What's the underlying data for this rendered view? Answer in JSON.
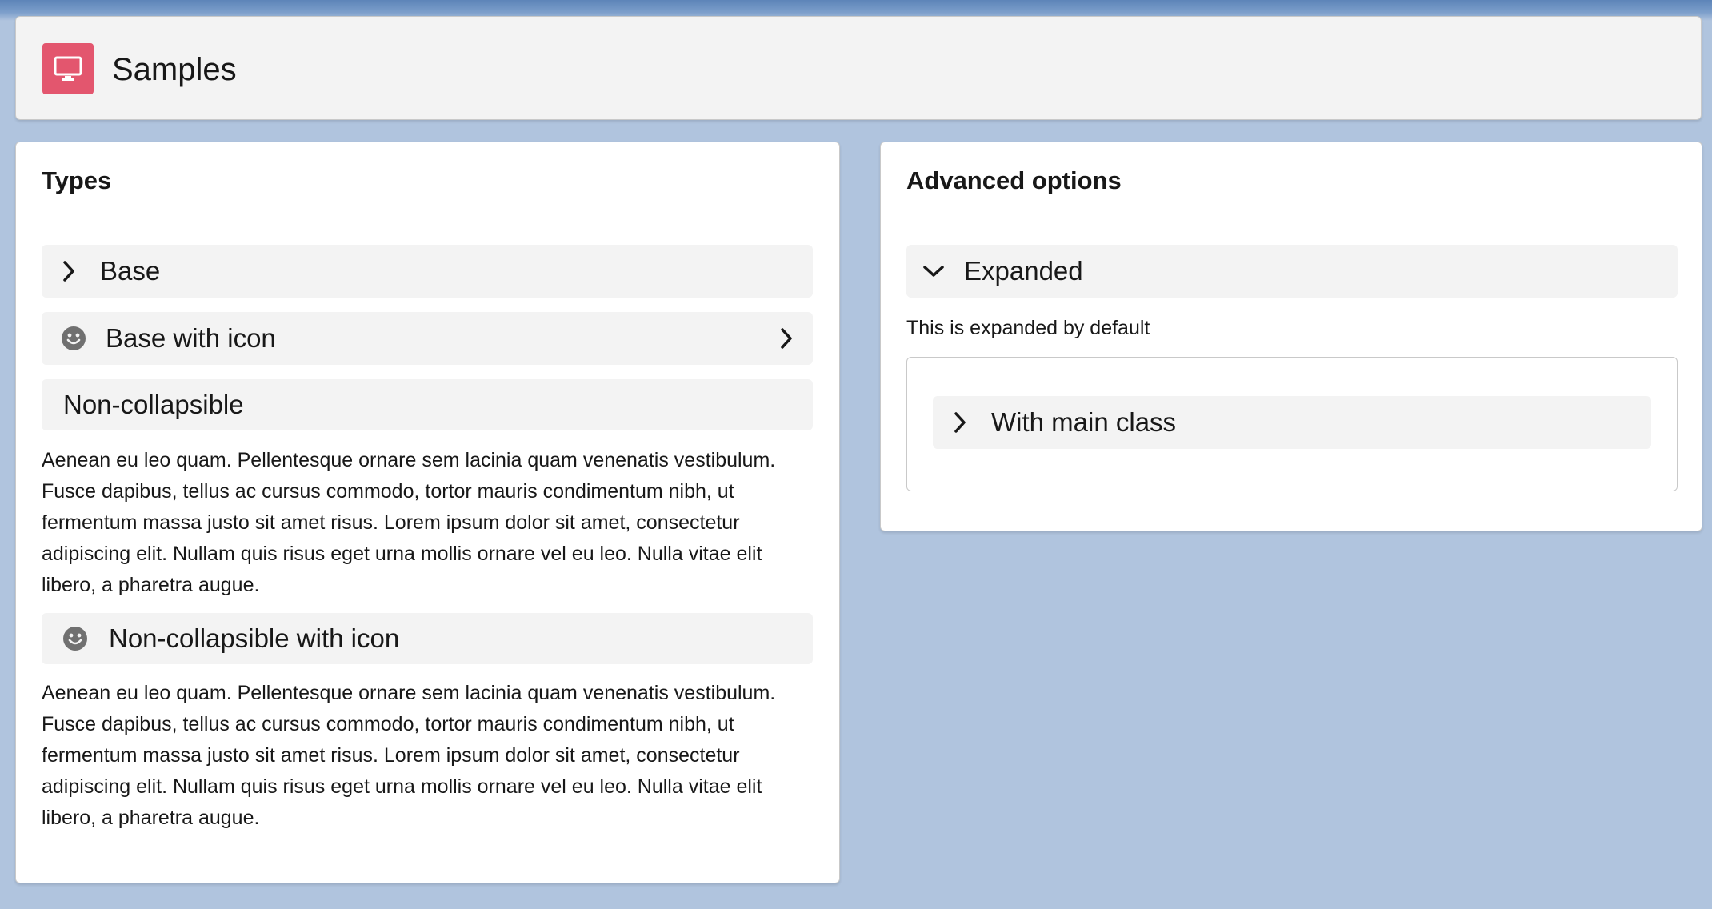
{
  "header": {
    "title": "Samples",
    "icon": "desktop-icon",
    "icon_color": "#e3566e"
  },
  "types_card": {
    "title": "Types",
    "sections": [
      {
        "title": "Base",
        "icon": "chevron-right-icon"
      },
      {
        "title": "Base with icon",
        "icon": "smiley-icon",
        "action_icon": "chevron-right-icon"
      },
      {
        "title": "Non-collapsible",
        "content": "Aenean eu leo quam. Pellentesque ornare sem lacinia quam venenatis vestibulum. Fusce dapibus, tellus ac cursus commodo, tortor mauris condimentum nibh, ut fermentum massa justo sit amet risus. Lorem ipsum dolor sit amet, consectetur adipiscing elit. Nullam quis risus eget urna mollis ornare vel eu leo. Nulla vitae elit libero, a pharetra augue."
      },
      {
        "title": "Non-collapsible with icon",
        "icon": "smiley-icon",
        "content": "Aenean eu leo quam. Pellentesque ornare sem lacinia quam venenatis vestibulum. Fusce dapibus, tellus ac cursus commodo, tortor mauris condimentum nibh, ut fermentum massa justo sit amet risus. Lorem ipsum dolor sit amet, consectetur adipiscing elit. Nullam quis risus eget urna mollis ornare vel eu leo. Nulla vitae elit libero, a pharetra augue."
      }
    ]
  },
  "advanced_card": {
    "title": "Advanced options",
    "expanded_section": {
      "title": "Expanded",
      "icon": "chevron-down-icon",
      "content": "This is expanded by default",
      "nested_section": {
        "title": "With main class",
        "icon": "chevron-right-icon"
      }
    }
  },
  "colors": {
    "page_background": "#b0c4de",
    "section_background": "#f3f3f3",
    "card_background": "#ffffff",
    "icon_gray": "#707070"
  }
}
